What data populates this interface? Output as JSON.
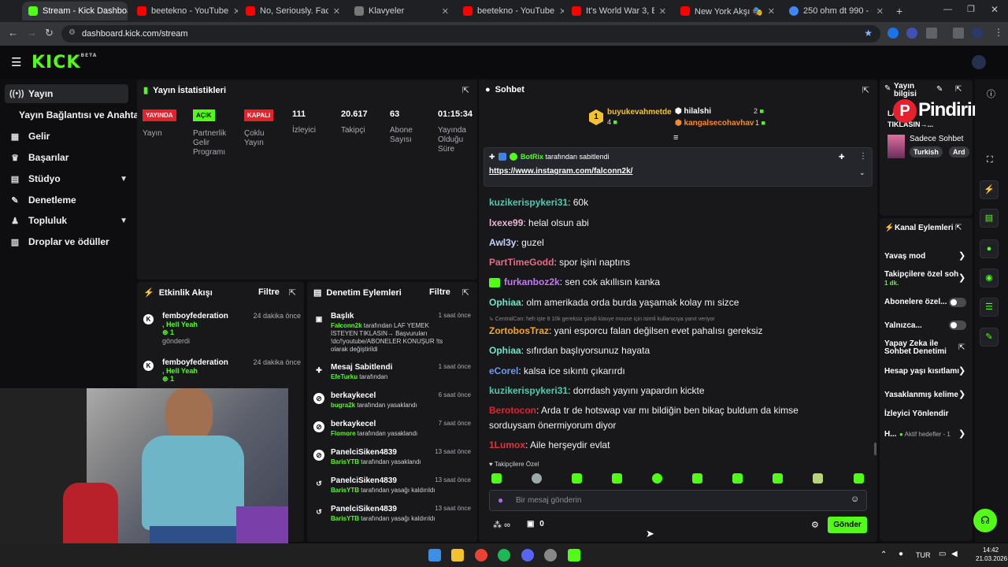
{
  "browser": {
    "tabs": [
      {
        "title": "Stream - Kick Dashboard",
        "color": "#53fc18"
      },
      {
        "title": "beetekno - YouTube",
        "color": "#ff0000"
      },
      {
        "title": "No, Seriously. Facebook's",
        "color": "#ff0000"
      },
      {
        "title": "Klavyeler",
        "color": "#888888"
      },
      {
        "title": "beetekno - YouTube",
        "color": "#ff0000"
      },
      {
        "title": "It's World War 3, But You",
        "color": "#ff0000"
      },
      {
        "title": "New York Akşı 🎭 Yarat",
        "color": "#ff0000"
      },
      {
        "title": "250 ohm dt 990 - Google",
        "color": "#4285f4"
      }
    ],
    "url": "dashboard.kick.com/stream"
  },
  "kick": {
    "logo": "KICK",
    "logo_sup": "BETA"
  },
  "sidebar": {
    "items": [
      {
        "label": "Yayın",
        "icon": "broadcast-icon"
      },
      {
        "label": "Yayın Bağlantısı ve Anahtarı",
        "icon": ""
      },
      {
        "label": "Gelir",
        "icon": "revenue-icon"
      },
      {
        "label": "Başarılar",
        "icon": "trophy-icon"
      },
      {
        "label": "Stüdyo",
        "icon": "studio-icon"
      },
      {
        "label": "Denetleme",
        "icon": "wrench-icon"
      },
      {
        "label": "Topluluk",
        "icon": "community-icon"
      },
      {
        "label": "Droplar ve ödüller",
        "icon": "drops-icon"
      }
    ]
  },
  "stats": {
    "title": "Yayın İstatistikleri",
    "badges": [
      {
        "badge": "YAYINDA",
        "label": "Yayın",
        "color": "#e5212d"
      },
      {
        "badge": "AÇIK",
        "label": "Partnerlik Gelir Programı",
        "color": "#53fc18"
      },
      {
        "badge": "KAPALI",
        "label": "Çoklu Yayın",
        "color": "#e5212d"
      }
    ],
    "numbers": [
      {
        "value": "111",
        "label": "İzleyici"
      },
      {
        "value": "20.617",
        "label": "Takipçi"
      },
      {
        "value": "63",
        "label": "Abone Sayısı"
      },
      {
        "value": "01:15:34",
        "label": "Yayında Olduğu Süre"
      }
    ]
  },
  "activity": {
    "title": "Etkinlik Akışı",
    "filter": "Filtre",
    "events": [
      {
        "user": "femboyfederation",
        "msg": ", Hell Yeah",
        "count": "1",
        "action": "gönderdi",
        "time": "24 dakika önce"
      },
      {
        "user": "femboyfederation",
        "msg": ", Hell Yeah",
        "count": "1",
        "action": "",
        "time": "24 dakika önce"
      }
    ]
  },
  "moderation": {
    "title": "Denetim Eylemleri",
    "filter": "Filtre",
    "items": [
      {
        "title": "Başlık",
        "time": "1 saat önce",
        "user": "Falconn2k",
        "rest": " tarafından LAF YEMEK İSTEYEN TIKLASIN→ Başvuruları !dc/!youtube/ABONELER KONUŞUR !ts olarak değiştirildi",
        "icon": "title-icon"
      },
      {
        "title": "Mesaj Sabitlendi",
        "time": "1 saat önce",
        "user": "EfeTurku",
        "rest": " tarafından",
        "icon": "pin-icon"
      },
      {
        "title": "berkaykecel",
        "time": "6 saat önce",
        "user": "bugra2k",
        "rest": " tarafından yasaklandı",
        "icon": "ban-icon"
      },
      {
        "title": "berkaykecel",
        "time": "7 saat önce",
        "user": "Flomore",
        "rest": " tarafından yasaklandı",
        "icon": "ban-icon"
      },
      {
        "title": "PanelciSiken4839",
        "time": "13 saat önce",
        "user": "BarisYTB",
        "rest": " tarafından yasaklandı",
        "icon": "ban-icon"
      },
      {
        "title": "PanelciSiken4839",
        "time": "13 saat önce",
        "user": "BarisYTB",
        "rest": " tarafından yasağı kaldırıldı",
        "icon": "undo-icon"
      },
      {
        "title": "PanelciSiken4839",
        "time": "13 saat önce",
        "user": "BarisYTB",
        "rest": " tarafından yasağı kaldırıldı",
        "icon": "undo-icon"
      }
    ]
  },
  "chat": {
    "title": "Sohbet",
    "top_gifters": [
      {
        "name": "buyukevahmetde",
        "count": "4",
        "rank": "1"
      },
      {
        "name": "hilalshi",
        "count": "2"
      },
      {
        "name": "kangalsecohavhav",
        "count": "1"
      }
    ],
    "pinned": {
      "by": "BotRix",
      "by_suffix": "tarafından sabitlendi",
      "link": "https://www.instagram.com/falconn2k/"
    },
    "messages": [
      {
        "user": "kuzikerispykeri31",
        "color": "#4ec9b0",
        "text": ": 60k"
      },
      {
        "user": "lxexe99",
        "color": "#e9b6d6",
        "text": ": helal olsun abi"
      },
      {
        "user": "Awl3y",
        "color": "#c8d2ff",
        "text": ": guzel"
      },
      {
        "user": "PartTimeGodd",
        "color": "#e86a85",
        "text": ": spor işini naptıns"
      },
      {
        "user": "furkanboz2k",
        "color": "#c17bf2",
        "text": ": sen cok akıllısın kanka"
      },
      {
        "user": "Ophiaa",
        "color": "#72e2c8",
        "text": ": olm amerikada orda burda yaşamak kolay mı sizce"
      },
      {
        "user": "ZortobosTraz",
        "color": "#f2a623",
        "text": ": yani esporcu falan değilsen evet pahalısı gereksiz"
      },
      {
        "user": "Ophiaa",
        "color": "#72e2c8",
        "text": ": sıfırdan başlıyorsunuz hayata"
      },
      {
        "user": "eCorel",
        "color": "#6c9cf5",
        "text": ": kalsa ice sıkıntı çıkarırdı"
      },
      {
        "user": "kuzikerispykeri31",
        "color": "#4ec9b0",
        "text": ": dorrdash yayını yapardın kickte"
      },
      {
        "user": "Berotocon",
        "color": "#e5212d",
        "text": ": Arda tr de hotswap var mı bildiğin ben bikaç buldum da kimse"
      },
      {
        "user": "",
        "color": "#f2f2f2",
        "text": "sorduysam önermiyorum diyor"
      },
      {
        "user": "1Lumox",
        "color": "#d9363e",
        "text": ": Aile herşeydir evlat"
      }
    ],
    "reply": "CentralCan: heh işte 8 10k gereksiz şimdi klavye mouse için isimli kullanıcıya yanıt veriyor",
    "followers_only": "Takipçilere Özel",
    "input_placeholder": "Bir mesaj gönderin",
    "points": "∞",
    "count": "0",
    "send": "Gönder"
  },
  "stream_info": {
    "title": "Yayın bilgisi",
    "stream_title": "LA",
    "stream_title2": "TIKLASIN→...",
    "category": "Sadece Sohbet",
    "tags": [
      "Turkish",
      "Ard"
    ],
    "overlay": "Pindirim"
  },
  "channel_actions": {
    "title": "Kanal Eylemleri",
    "items": [
      {
        "label": "Yavaş mod",
        "kind": "chevron"
      },
      {
        "label": "Takipçilere özel soh",
        "sub": "1 dk.",
        "kind": "chevron"
      },
      {
        "label": "Abonelere özel...",
        "kind": "toggle"
      },
      {
        "label": "Yalnızca...",
        "kind": "toggle"
      },
      {
        "label": "Yapay Zeka ile Sohbet Denetimi",
        "kind": "popout"
      },
      {
        "label": "Hesap yaşı kısıtlamı",
        "kind": "chevron"
      },
      {
        "label": "Yasaklanmış kelime",
        "kind": "chevron"
      },
      {
        "label": "İzleyici Yönlendir",
        "kind": "none"
      },
      {
        "label": "H...",
        "sub": "Aktif hedefler - 1",
        "kind": "chevron"
      }
    ]
  },
  "taskbar": {
    "lang": "TUR",
    "time": "14:42",
    "date": "21.03.2026"
  }
}
